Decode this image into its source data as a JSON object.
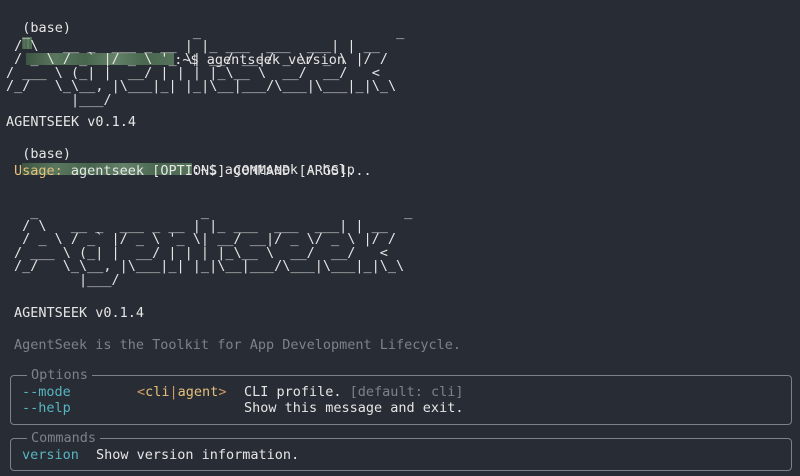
{
  "terminal": {
    "prompt_env": "(base)",
    "prompt_suffix": ":~$",
    "cmd1": "agentseek version",
    "cmd2": "agentseek --help",
    "logo_art": "  _                    _                        _\n / \\   __ _  ___ _ __ | |_ ___  ___  ___| | __\n / _ \\ / _` |/ _ \\ '_ \\| __/ __|/ _ \\/ _ \\ |/ /\n/ ___ \\ (_| |  __/ | | | |_\\__ \\  __/  __/   <\n/_/   \\_\\__, |\\___|_| |_|\\__|___/\\___|\\___|_|\\_\\\n        |___/",
    "version_line": "AGENTSEEK v0.1.4",
    "usage_label": "Usage:",
    "usage_text": " agentseek [OPTIONS] COMMAND [ARGS]...",
    "description": "AgentSeek is the Toolkit for App Development Lifecycle.",
    "options": {
      "title": "Options",
      "rows": [
        {
          "flag": "--mode",
          "choice_open": "<",
          "choice_a": "cli",
          "choice_sep": "|",
          "choice_b": "agent",
          "choice_close": ">",
          "desc": "CLI profile. ",
          "default": "[default: cli]"
        },
        {
          "flag": "--help",
          "desc": "Show this message and exit."
        }
      ]
    },
    "commands": {
      "title": "Commands",
      "rows": [
        {
          "name": "version",
          "desc": "Show version information."
        }
      ]
    }
  },
  "colors": {
    "background": "#282c34",
    "text": "#e6e6e6",
    "cyan": "#56b6c2",
    "yellow": "#e5c07b",
    "orange": "#d19a66",
    "muted": "#7c828d"
  }
}
